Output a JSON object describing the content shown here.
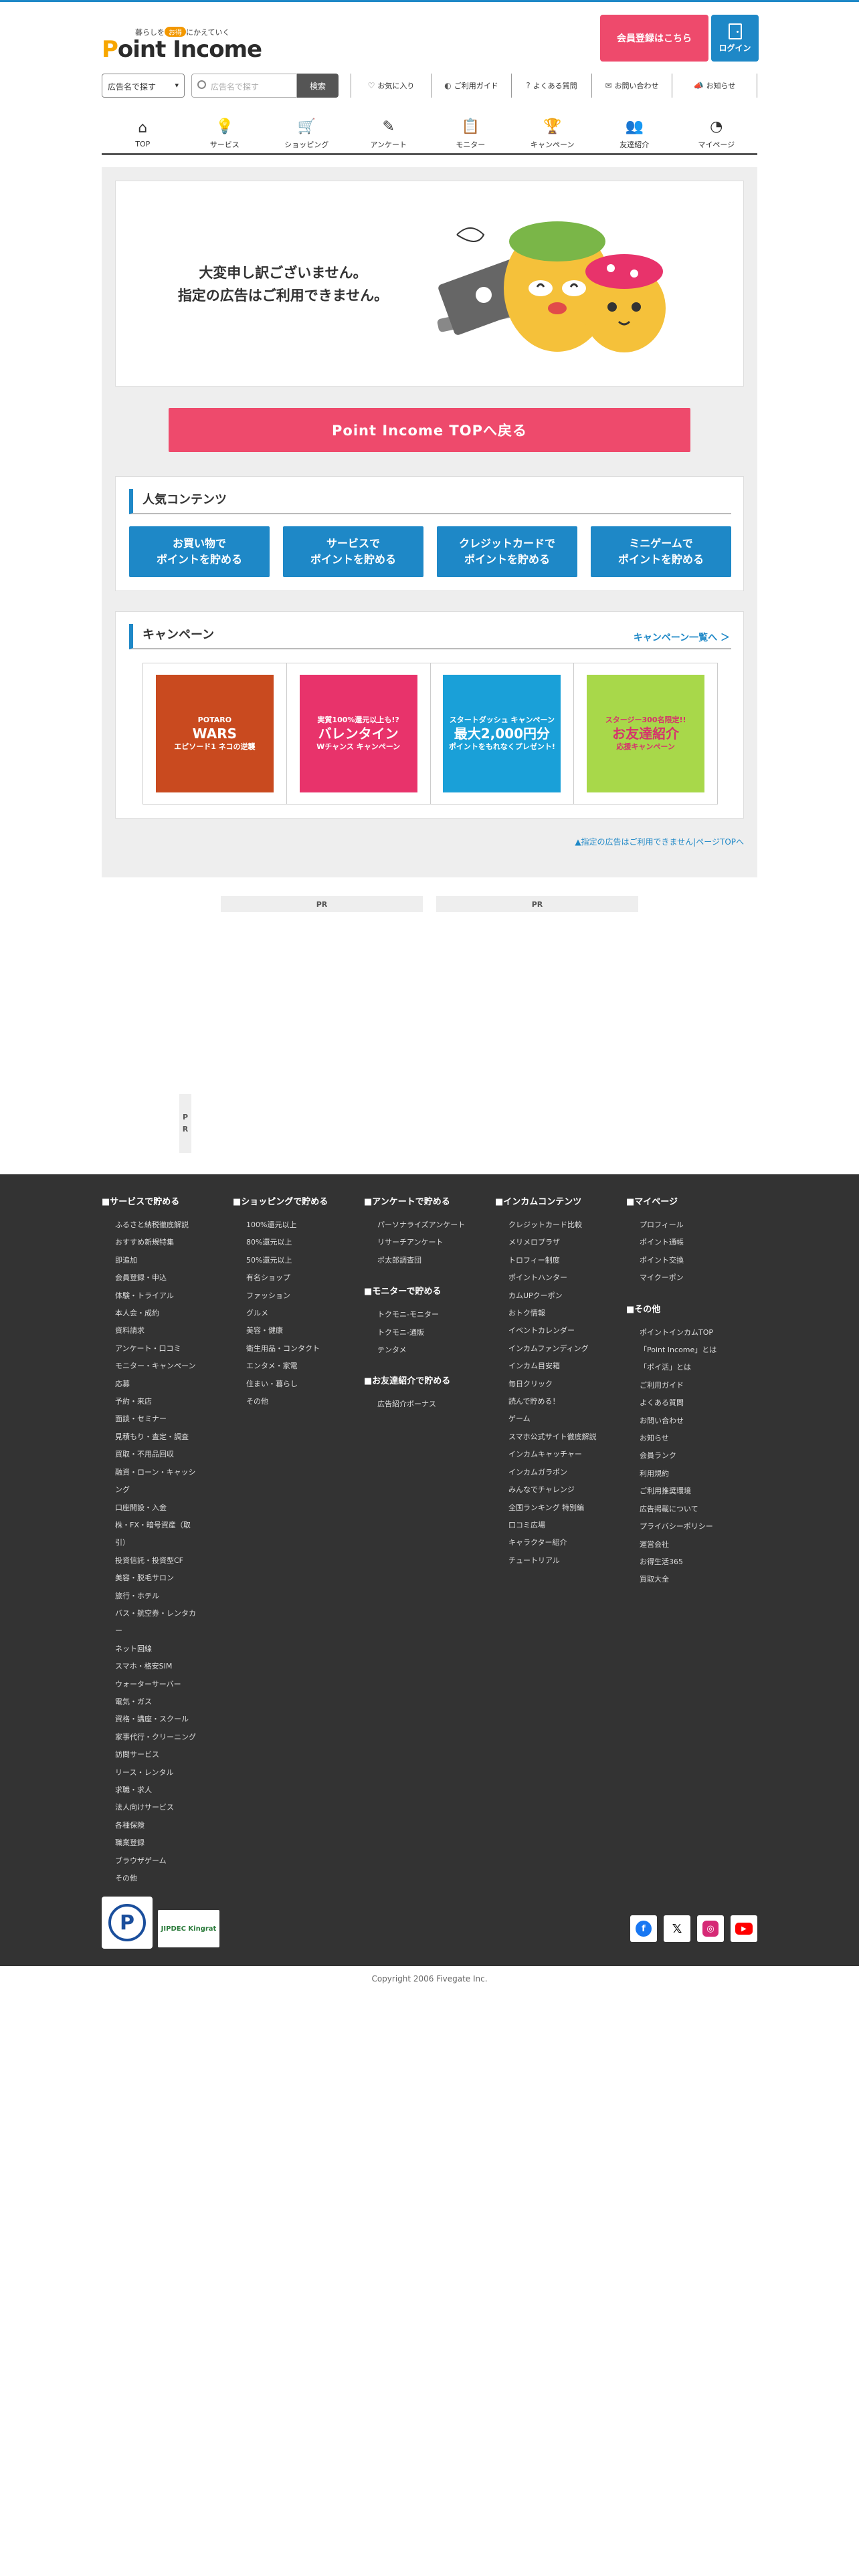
{
  "header": {
    "tagline_pre": "暮らしを",
    "tagline_pill": "お得",
    "tagline_post": "にかえていく",
    "logo_p": "P",
    "logo_rest": "oint Income",
    "register_label": "会員登録はこちら",
    "login_label": "ログイン"
  },
  "search": {
    "select_value": "広告名で探す",
    "placeholder": "広告名で探す",
    "button_label": "検索"
  },
  "utility": [
    {
      "icon": "heart-icon",
      "glyph": "♡",
      "label": "お気に入り"
    },
    {
      "icon": "guide-icon",
      "glyph": "◐",
      "label": "ご利用ガイド"
    },
    {
      "icon": "question-icon",
      "glyph": "?",
      "label": "よくある質問"
    },
    {
      "icon": "mail-icon",
      "glyph": "✉",
      "label": "お問い合わせ"
    },
    {
      "icon": "megaphone-icon",
      "glyph": "📣",
      "label": "お知らせ"
    }
  ],
  "nav": [
    {
      "icon": "home-icon",
      "glyph": "⌂",
      "label": "TOP"
    },
    {
      "icon": "bulb-icon",
      "glyph": "💡",
      "label": "サービス"
    },
    {
      "icon": "cart-icon",
      "glyph": "🛒",
      "label": "ショッピング"
    },
    {
      "icon": "pencil-icon",
      "glyph": "✎",
      "label": "アンケート"
    },
    {
      "icon": "clipboard-icon",
      "glyph": "📋",
      "label": "モニター"
    },
    {
      "icon": "trophy-icon",
      "glyph": "🏆",
      "label": "キャンペーン"
    },
    {
      "icon": "friends-icon",
      "glyph": "👥",
      "label": "友達紹介"
    },
    {
      "icon": "gauge-icon",
      "glyph": "◔",
      "label": "マイページ"
    }
  ],
  "notice": {
    "line1": "大変申し訳ございません。",
    "line2": "指定の広告はご利用できません。"
  },
  "back_button": "Point Income TOPへ戻る",
  "popular": {
    "title": "人気コンテンツ",
    "buttons": [
      "お買い物で\nポイントを貯める",
      "サービスで\nポイントを貯める",
      "クレジットカードで\nポイントを貯める",
      "ミニゲームで\nポイントを貯める"
    ]
  },
  "campaign": {
    "title": "キャンペーン",
    "link": "キャンペーン一覧へ ＞",
    "banners": [
      {
        "l1": "POTARO",
        "l2": "WARS",
        "l3": "エピソード1 ネコの逆襲",
        "bg": "#c94a1f",
        "fg": "#ffffff"
      },
      {
        "l1": "実質100%還元以上も!?",
        "l2": "バレンタイン",
        "l3": "Wチャンス キャンペーン",
        "bg": "#e8336b",
        "fg": "#ffffff"
      },
      {
        "l1": "スタートダッシュ キャンペーン",
        "l2": "最大2,000円分",
        "l3": "ポイントをもれなくプレゼント!",
        "bg": "#1aa0d8",
        "fg": "#ffffff"
      },
      {
        "l1": "スタージー300名限定!!",
        "l2": "お友達紹介",
        "l3": "応援キャンペーン",
        "bg": "#a8d84a",
        "fg": "#d6336c"
      }
    ]
  },
  "pagetop": "▲指定の広告はご利用できません|ページTOPへ",
  "pr": {
    "label": "PR",
    "side_l1": "P",
    "side_l2": "R"
  },
  "footer": {
    "col1": {
      "head": "■サービスで貯める",
      "items": [
        "ふるさと納税徹底解説",
        "おすすめ新規特集",
        "即追加",
        "会員登録・申込",
        "体験・トライアル",
        "本人会・成約",
        "資料請求",
        "アンケート・口コミ",
        "モニター・キャンペーン",
        "応募",
        "予約・来店",
        "面談・セミナー",
        "見積もり・査定・調査",
        "買取・不用品回収",
        "融資・ローン・キャッシ",
        "ング",
        "口座開設・入金",
        "株・FX・暗号資産（取",
        "引）",
        "投資信託・投資型CF",
        "美容・脱毛サロン",
        "旅行・ホテル",
        "バス・航空券・レンタカ",
        "ー",
        "ネット回線",
        "スマホ・格安SIM",
        "ウォーターサーバー",
        "電気・ガス",
        "資格・講座・スクール",
        "家事代行・クリーニング",
        "訪問サービス",
        "リース・レンタル",
        "求職・求人",
        "法人向けサービス",
        "各種保険",
        "職業登録",
        "ブラウザゲーム",
        "その他"
      ]
    },
    "col2": {
      "head": "■ショッピングで貯める",
      "items": [
        "100%還元以上",
        "80%還元以上",
        "50%還元以上",
        "有名ショップ",
        "ファッション",
        "グルメ",
        "美容・健康",
        "衛生用品・コンタクト",
        "エンタメ・家電",
        "住まい・暮らし",
        "その他"
      ]
    },
    "col3a": {
      "head": "■アンケートで貯める",
      "items": [
        "パーソナライズアンケート",
        "リサーチアンケート",
        "ポ太郎調査団"
      ]
    },
    "col3b": {
      "head": "■モニターで貯める",
      "items": [
        "トクモニ-モニター",
        "トクモニ-通販",
        "テンタメ"
      ]
    },
    "col3c": {
      "head": "■お友達紹介で貯める",
      "items": [
        "広告紹介ボーナス"
      ]
    },
    "col4": {
      "head": "■インカムコンテンツ",
      "items": [
        "クレジットカード比較",
        "メリメロプラザ",
        "トロフィー制度",
        "ポイントハンター",
        "カムUPクーポン",
        "おトク情報",
        "イベントカレンダー",
        "インカムファンディング",
        "インカム目安箱",
        "毎日クリック",
        "読んで貯める！",
        "ゲーム",
        "スマホ公式サイト徹底解説",
        "インカムキャッチャー",
        "インカムガラポン",
        "みんなでチャレンジ",
        "全国ランキング 特別編",
        "口コミ広場",
        "キャラクター紹介",
        "チュートリアル"
      ]
    },
    "col5a": {
      "head": "■マイページ",
      "items": [
        "プロフィール",
        "ポイント通帳",
        "ポイント交換",
        "マイクーポン"
      ]
    },
    "col5b": {
      "head": "■その他",
      "items": [
        "ポイントインカムTOP",
        "「Point Income」とは",
        "「ポイ活」とは",
        "ご利用ガイド",
        "よくある質問",
        "お問い合わせ",
        "お知らせ",
        "会員ランク",
        "利用規約",
        "ご利用推奨環境",
        "広告掲載について",
        "プライバシーポリシー",
        "運営会社",
        "お得生活365",
        "買取大全"
      ]
    },
    "badge1": "P",
    "badge2": "JIPDEC Kingrat"
  },
  "social": [
    {
      "icon": "facebook-icon",
      "glyph": "f",
      "color": "#1877f2"
    },
    {
      "icon": "x-icon",
      "glyph": "𝕏",
      "color": "#000000"
    },
    {
      "icon": "instagram-icon",
      "glyph": "◎",
      "color": "#d62976"
    },
    {
      "icon": "youtube-icon",
      "glyph": "▶",
      "color": "#ff0000"
    }
  ],
  "copyright": "Copyright 2006 Fivegate Inc."
}
